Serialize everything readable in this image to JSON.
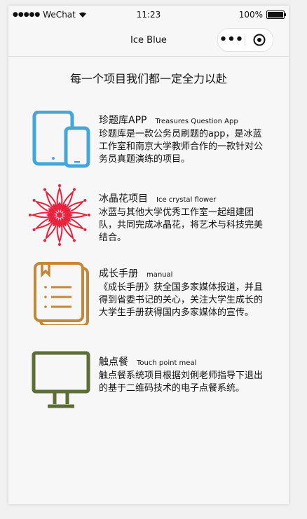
{
  "statusbar": {
    "carrier": "WeChat",
    "time": "11:23",
    "battery": "100%",
    "battery_level": 1.0
  },
  "navbar": {
    "title": "Ice Blue",
    "more_icon": "more-dots-icon",
    "close_icon": "target-circle-icon"
  },
  "headline": "每一个项目我们都一定全力以赴",
  "projects": [
    {
      "title": "珍题库APP",
      "subtitle": "Treasures Question App",
      "description": "珍题库是一款公务员刷题的app，是冰蓝工作室和南京大学教师合作的一款针对公务员真题演练的项目。",
      "icon": "tablet-phone-icon",
      "color": "#45a7d9"
    },
    {
      "title": "冰晶花项目",
      "subtitle": "Ice crystal flower",
      "description": "冰蓝与其他大学优秀工作室一起组建团队，共同完成冰晶花，将艺术与科技完美结合。",
      "icon": "ice-crystal-flower-icon",
      "color": "#e8223c"
    },
    {
      "title": "成长手册",
      "subtitle": "manual",
      "description": "《成长手册》获全国多家媒体报道，并且得到省委书记的关心，关注大学生成长的大学生手册获得国内多家媒体的宣传。",
      "icon": "manual-book-icon",
      "color": "#c1883a"
    },
    {
      "title": "触点餐",
      "subtitle": "Touch point meal",
      "description": "触点餐系统项目根据刘俐老师指导下退出的基于二维码技术的电子点餐系统。",
      "icon": "monitor-icon",
      "color": "#5e6c36"
    }
  ]
}
